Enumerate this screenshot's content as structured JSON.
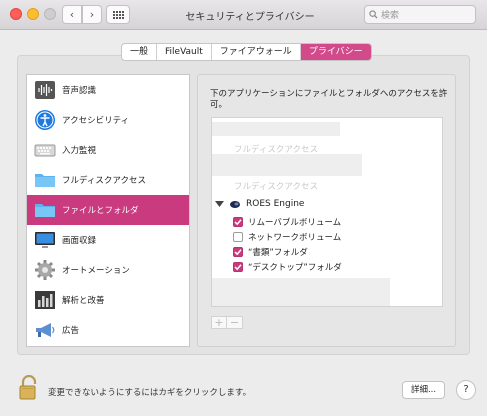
{
  "window": {
    "title": "セキュリティとプライバシー"
  },
  "search": {
    "placeholder": "検索"
  },
  "tabs": [
    {
      "label": "一般",
      "active": false
    },
    {
      "label": "FileVault",
      "active": false
    },
    {
      "label": "ファイアウォール",
      "active": false
    },
    {
      "label": "プライバシー",
      "active": true
    }
  ],
  "sidebar": {
    "items": [
      {
        "label": "音声認識",
        "icon": "waveform-icon"
      },
      {
        "label": "アクセシビリティ",
        "icon": "accessibility-icon"
      },
      {
        "label": "入力監視",
        "icon": "keyboard-icon"
      },
      {
        "label": "フルディスクアクセス",
        "icon": "folder-icon"
      },
      {
        "label": "ファイルとフォルダ",
        "icon": "folder-icon",
        "selected": true
      },
      {
        "label": "画面収録",
        "icon": "display-icon"
      },
      {
        "label": "オートメーション",
        "icon": "gear-icon"
      },
      {
        "label": "解析と改善",
        "icon": "bar-chart-icon"
      },
      {
        "label": "広告",
        "icon": "megaphone-icon"
      }
    ]
  },
  "main": {
    "description": "下のアプリケーションにファイルとフォルダへのアクセスを許可。",
    "ghost_labels": [
      "フルディスクアクセス",
      "フルディスクアクセス"
    ],
    "app": {
      "name": "ROES Engine",
      "permissions": [
        {
          "label": "リムーバブルボリューム",
          "checked": true
        },
        {
          "label": "ネットワークボリューム",
          "checked": false
        },
        {
          "label": "“書類”フォルダ",
          "checked": true
        },
        {
          "label": "“デスクトップ”フォルダ",
          "checked": true
        }
      ]
    },
    "add_label": "+",
    "remove_label": "−"
  },
  "footer": {
    "lock_text": "変更できないようにするにはカギをクリックします。",
    "advanced_label": "詳細...",
    "help_label": "?"
  },
  "colors": {
    "accent": "#c93b7e"
  }
}
